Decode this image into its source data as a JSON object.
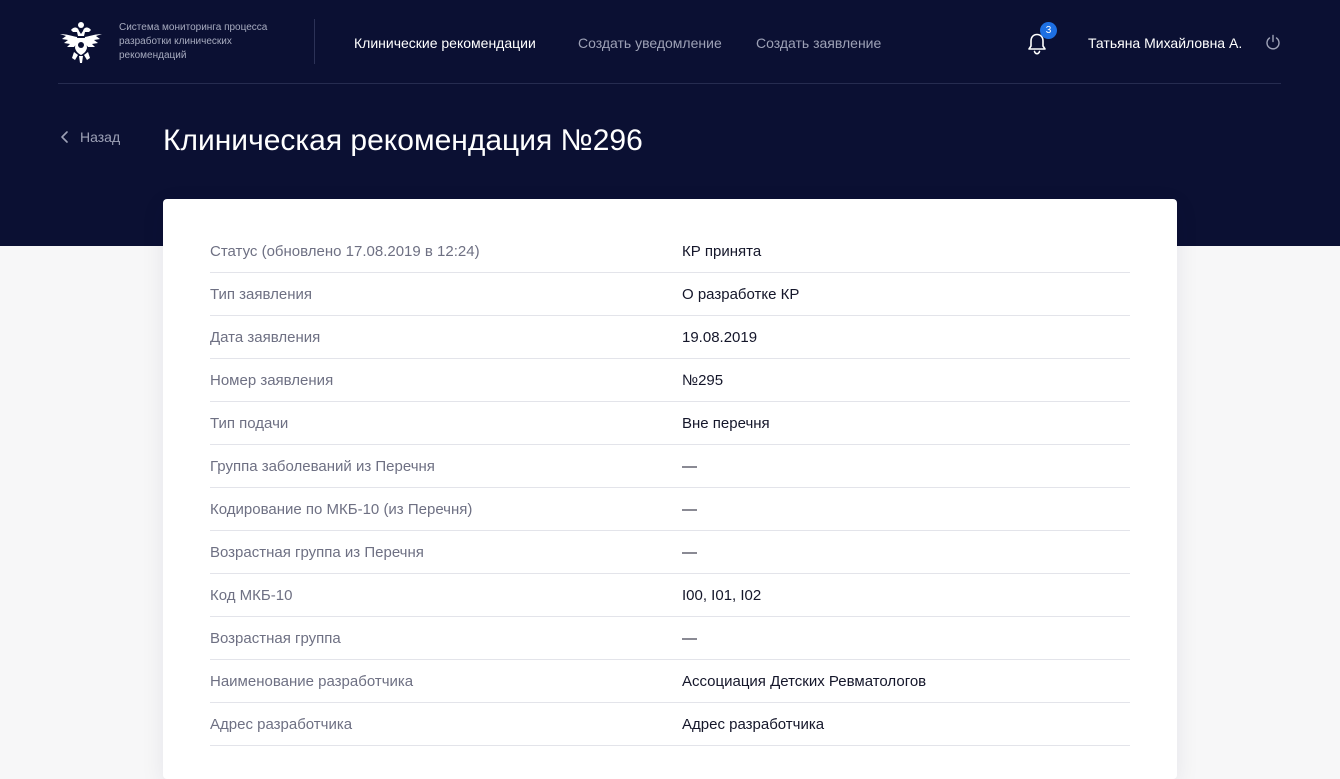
{
  "header": {
    "logo_icon": "double-headed-eagle-emblem-icon",
    "system_name": "Система мониторинга процесса разработки клинических рекомендаций",
    "nav": [
      {
        "label": "Клинические рекомендации",
        "active": true
      },
      {
        "label": "Создать уведомление",
        "active": false
      },
      {
        "label": "Создать заявление",
        "active": false
      }
    ],
    "notifications": {
      "icon": "bell-icon",
      "count": "3"
    },
    "user_name": "Татьяна Михайловна А.",
    "logout_icon": "power-icon"
  },
  "page": {
    "back_label": "Назад",
    "back_icon": "chevron-left-icon",
    "title": "Клиническая рекомендация №296"
  },
  "details": [
    {
      "label": "Статус (обновлено 17.08.2019 в 12:24)",
      "value": "КР принята"
    },
    {
      "label": "Тип заявления",
      "value": "О разработке КР"
    },
    {
      "label": "Дата заявления",
      "value": "19.08.2019"
    },
    {
      "label": "Номер заявления",
      "value": "№295"
    },
    {
      "label": "Тип подачи",
      "value": "Вне перечня"
    },
    {
      "label": "Группа заболеваний из Перечня",
      "value": "—"
    },
    {
      "label": "Кодирование по МКБ-10 (из Перечня)",
      "value": "—"
    },
    {
      "label": "Возрастная группа из Перечня",
      "value": "—"
    },
    {
      "label": "Код МКБ-10",
      "value": "I00, I01, I02"
    },
    {
      "label": "Возрастная группа",
      "value": "—"
    },
    {
      "label": "Наименование разработчика",
      "value": "Ассоциация Детских Ревматологов"
    },
    {
      "label": "Адрес разработчика",
      "value": "Адрес разработчика"
    }
  ],
  "colors": {
    "header_bg": "#0b1033",
    "accent": "#1d6fe3",
    "page_bg": "#f7f7f8"
  }
}
